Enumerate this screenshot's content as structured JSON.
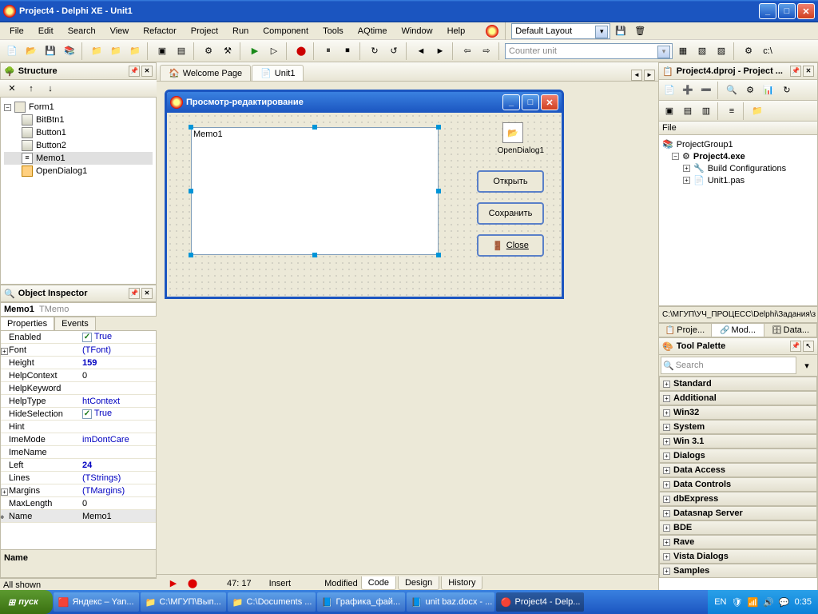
{
  "title": "Project4 - Delphi XE - Unit1",
  "menu": [
    "File",
    "Edit",
    "Search",
    "View",
    "Refactor",
    "Project",
    "Run",
    "Component",
    "Tools",
    "AQtime",
    "Window",
    "Help"
  ],
  "layout_combo": "Default Layout",
  "counter_combo": "Counter unit",
  "structure": {
    "title": "Structure",
    "root": "Form1",
    "children": [
      "BitBtn1",
      "Button1",
      "Button2",
      "Memo1",
      "OpenDialog1"
    ]
  },
  "tabs": {
    "welcome": "Welcome Page",
    "unit": "Unit1"
  },
  "form": {
    "title": "Просмотр-редактирование",
    "memo_text": "Memo1",
    "opendialog": "OpenDialog1",
    "btn_open": "Открыть",
    "btn_save": "Сохранить",
    "btn_close": "Close"
  },
  "bottom_tabs": [
    "Code",
    "Design",
    "History"
  ],
  "statusbar": {
    "pos": "47: 17",
    "mode": "Insert",
    "state": "Modified",
    "all": "All shown"
  },
  "object_inspector": {
    "title": "Object Inspector",
    "obj": "Memo1",
    "cls": "TMemo",
    "tabs": [
      "Properties",
      "Events"
    ],
    "footer_label": "Name",
    "props": [
      {
        "n": "Enabled",
        "v": "True",
        "t": "check"
      },
      {
        "n": "Font",
        "v": "(TFont)",
        "t": "link",
        "e": "+"
      },
      {
        "n": "Height",
        "v": "159",
        "t": "bold"
      },
      {
        "n": "HelpContext",
        "v": "0"
      },
      {
        "n": "HelpKeyword",
        "v": ""
      },
      {
        "n": "HelpType",
        "v": "htContext",
        "t": "link"
      },
      {
        "n": "HideSelection",
        "v": "True",
        "t": "check"
      },
      {
        "n": "Hint",
        "v": ""
      },
      {
        "n": "ImeMode",
        "v": "imDontCare",
        "t": "link"
      },
      {
        "n": "ImeName",
        "v": ""
      },
      {
        "n": "Left",
        "v": "24",
        "t": "bold"
      },
      {
        "n": "Lines",
        "v": "(TStrings)",
        "t": "link"
      },
      {
        "n": "Margins",
        "v": "(TMargins)",
        "t": "link",
        "e": "+"
      },
      {
        "n": "MaxLength",
        "v": "0"
      },
      {
        "n": "Name",
        "v": "Memo1",
        "sel": true
      }
    ]
  },
  "project_mgr": {
    "title": "Project4.dproj - Project ...",
    "file_label": "File",
    "root": "ProjectGroup1",
    "exe": "Project4.exe",
    "children": [
      "Build Configurations",
      "Unit1.pas"
    ],
    "path": "C:\\МГУП\\УЧ_ПРОЦЕСС\\Delphi\\Задания\\з",
    "rtabs": [
      "Proje...",
      "Mod...",
      "Data..."
    ]
  },
  "palette": {
    "title": "Tool Palette",
    "search": "Search",
    "sections": [
      "Standard",
      "Additional",
      "Win32",
      "System",
      "Win 3.1",
      "Dialogs",
      "Data Access",
      "Data Controls",
      "dbExpress",
      "Datasnap Server",
      "BDE",
      "Rave",
      "Vista Dialogs",
      "Samples"
    ]
  },
  "taskbar": {
    "start": "пуск",
    "tasks": [
      "Яндекс – Yan...",
      "C:\\МГУП\\Вып...",
      "C:\\Documents ...",
      "Графика_фай...",
      "unit baz.docx - ...",
      "Project4 - Delp..."
    ],
    "lang": "EN",
    "time": "0:35"
  }
}
